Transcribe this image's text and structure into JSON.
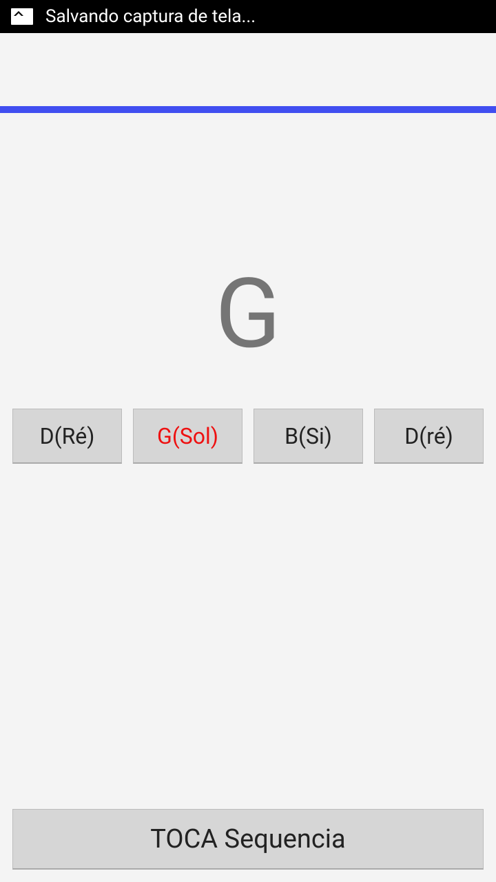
{
  "status_bar": {
    "text": "Salvando captura de tela..."
  },
  "current_note": "G",
  "string_buttons": [
    {
      "label": "D(Ré)",
      "selected": false
    },
    {
      "label": "G(Sol)",
      "selected": true
    },
    {
      "label": "B(Si)",
      "selected": false
    },
    {
      "label": "D(ré)",
      "selected": false
    }
  ],
  "play_button": {
    "label": "TOCA Sequencia"
  }
}
